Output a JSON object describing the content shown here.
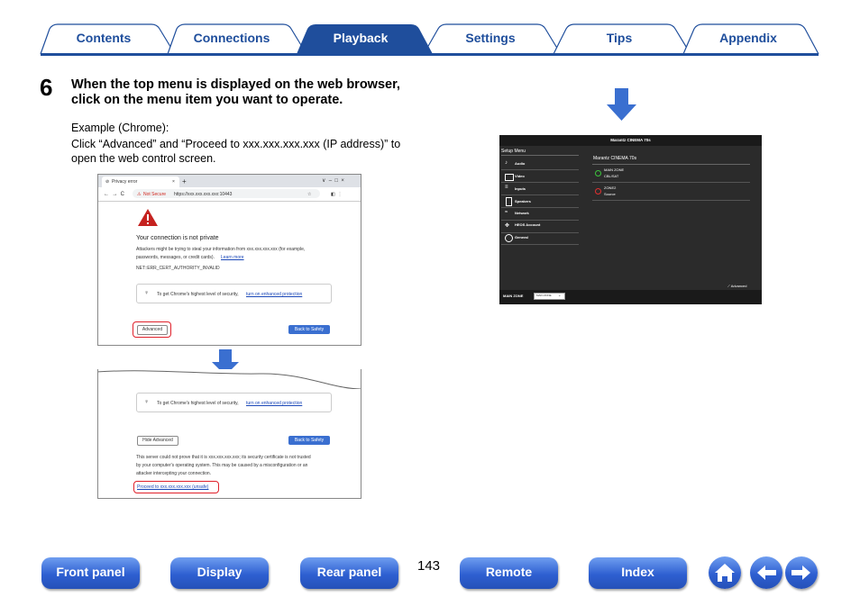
{
  "tabs": [
    {
      "label": "Contents"
    },
    {
      "label": "Connections"
    },
    {
      "label": "Playback"
    },
    {
      "label": "Settings"
    },
    {
      "label": "Tips"
    },
    {
      "label": "Appendix"
    }
  ],
  "step": {
    "number": "6",
    "title": "When the top menu is displayed on the web browser, click on the menu item you want to operate.",
    "example": "Example (Chrome):",
    "instruction": "Click “Advanced” and “Proceed to xxx.xxx.xxx.xxx (IP address)” to open the web control screen."
  },
  "browser": {
    "tab_title": "Privacy error",
    "not_secure": "Not Secure",
    "url": "https://xxx.xxx.xxx.xxx:10443",
    "heading": "Your connection is not private",
    "body_line1": "Attackers might be trying to steal your information from xxx.xxx.xxx.xxx (for example,",
    "body_line2": "passwords, messages, or credit cards).",
    "learn_more": "Learn more",
    "error_code": "NET::ERR_CERT_AUTHORITY_INVALID",
    "tip_text": "To get Chrome's highest level of security,",
    "tip_link": "turn on enhanced protection",
    "advanced": "Advanced",
    "back_to_safety": "Back to Safety",
    "hide_advanced": "Hide Advanced",
    "adv_line1": "This server could not prove that it is xxx.xxx.xxx.xxx; its security certificate is not trusted",
    "adv_line2": "by your computer's operating system. This may be caused by a misconfiguration or an",
    "adv_line3": "attacker intercepting your connection.",
    "proceed_link": "Proceed to xxx.xxx.xxx.xxx (unsafe)"
  },
  "web_control": {
    "title": "Marantz CINEMA 70s",
    "setup_menu": "Setup Menu",
    "menu_items": [
      "Audio",
      "Video",
      "Inputs",
      "Speakers",
      "Network",
      "HEOS Account",
      "General"
    ],
    "device_name": "Marantz CINEMA 70s",
    "zones": [
      {
        "name": "MAIN ZONE",
        "source": "CBL/SAT",
        "power_color": "#3cc43c"
      },
      {
        "name": "ZONE2",
        "source": "Source",
        "power_color": "#e03030"
      }
    ],
    "advanced": "Advanced",
    "footer_zone": "MAIN ZONE",
    "footer_select": "MAIN ZONE"
  },
  "page_number": "143",
  "bottom_nav": {
    "front_panel": "Front panel",
    "display": "Display",
    "rear_panel": "Rear panel",
    "remote": "Remote",
    "index": "Index"
  },
  "icons": {
    "home": "home-icon",
    "back": "arrow-left-icon",
    "forward": "arrow-right-icon"
  },
  "colors": {
    "accent": "#1f4e9c",
    "button": "#2e5fd1",
    "arrow": "#3a6fd0"
  }
}
